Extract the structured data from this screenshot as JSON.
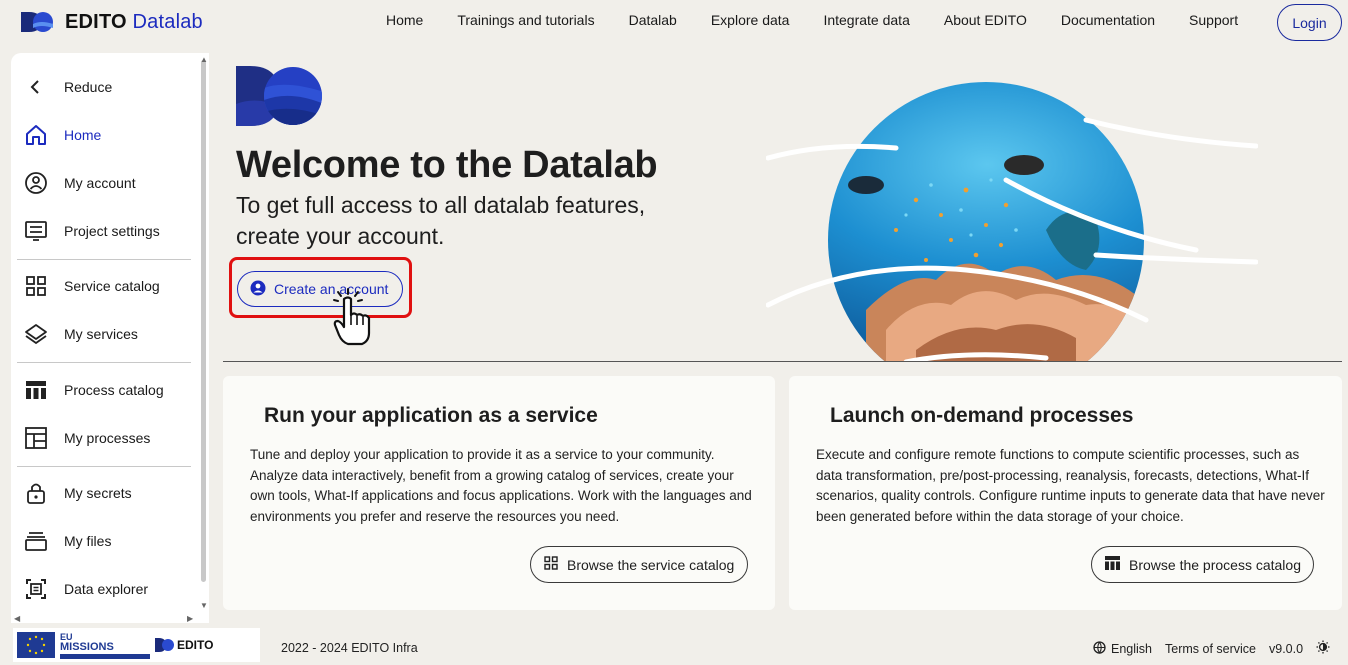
{
  "brand": {
    "name": "EDITO",
    "sub": "Datalab"
  },
  "nav": [
    "Home",
    "Trainings and tutorials",
    "Datalab",
    "Explore data",
    "Integrate data",
    "About EDITO",
    "Documentation",
    "Support"
  ],
  "login_label": "Login",
  "sidebar": {
    "items": [
      {
        "label": "Reduce",
        "icon": "chevron-left-icon"
      },
      {
        "label": "Home",
        "icon": "home-icon",
        "active": true
      },
      {
        "label": "My account",
        "icon": "account-icon"
      },
      {
        "label": "Project settings",
        "icon": "project-settings-icon"
      },
      {
        "label": "Service catalog",
        "icon": "grid-icon"
      },
      {
        "label": "My services",
        "icon": "layers-icon"
      },
      {
        "label": "Process catalog",
        "icon": "table-icon"
      },
      {
        "label": "My processes",
        "icon": "processes-icon"
      },
      {
        "label": "My secrets",
        "icon": "lock-icon"
      },
      {
        "label": "My files",
        "icon": "files-icon"
      },
      {
        "label": "Data explorer",
        "icon": "data-explorer-icon"
      }
    ]
  },
  "hero": {
    "title": "Welcome to the Datalab",
    "subtitle": "To get full access to all datalab features, create your account.",
    "create_label": "Create an account"
  },
  "cards": [
    {
      "title": "Run your application as a service",
      "description": "Tune and deploy your application to provide it as a service to your community. Analyze data interactively, benefit from a growing catalog of services, create your own tools, What-If applications and focus applications. Work with the languages and environments you prefer and reserve the resources you need.",
      "button": "Browse the service catalog"
    },
    {
      "title": "Launch on-demand processes",
      "description": "Execute and configure remote functions to compute scientific processes, such as data transformation, pre/post-processing, reanalysis, forecasts, detections, What-If scenarios, quality controls. Configure runtime inputs to generate data that have never been generated before within the data storage of your choice.",
      "button": "Browse the process catalog"
    }
  ],
  "footer": {
    "missions_line1": "EU",
    "missions_line2": "MISSIONS",
    "edito_logo": "EDITO",
    "copyright": "2022 - 2024 EDITO Infra",
    "language": "English",
    "terms": "Terms of service",
    "version": "v9.0.0"
  },
  "colors": {
    "accent": "#1c2bbf",
    "highlight": "#e01010",
    "background": "#f1efea"
  }
}
